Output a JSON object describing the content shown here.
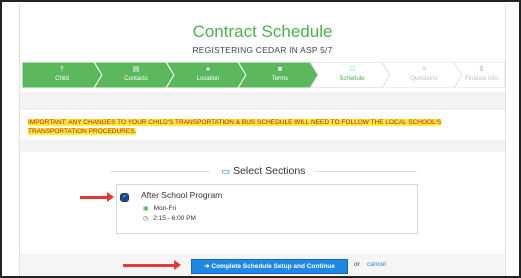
{
  "header": {
    "title": "Contract Schedule",
    "subtitle": "REGISTERING CEDAR IN ASP 5/7"
  },
  "steps": [
    {
      "label": "Child",
      "icon": "person-icon",
      "glyph": "†",
      "status": "done"
    },
    {
      "label": "Contacts",
      "icon": "contacts-icon",
      "glyph": "▤",
      "status": "done"
    },
    {
      "label": "Location",
      "icon": "location-pin-icon",
      "glyph": "●",
      "status": "done"
    },
    {
      "label": "Terms",
      "icon": "document-icon",
      "glyph": "■",
      "status": "done"
    },
    {
      "label": "Schedule",
      "icon": "calendar-icon",
      "glyph": "□",
      "status": "current"
    },
    {
      "label": "Questions",
      "icon": "list-icon",
      "glyph": "≡",
      "status": "todo"
    },
    {
      "label": "Finance Info",
      "icon": "dollar-icon",
      "glyph": "$",
      "status": "todo"
    }
  ],
  "notice": "IMPORTANT: ANY CHANGES TO YOUR CHILD'S TRANSPORTATION & BUS SCHEDULE WILL NEED TO FOLLOW THE LOCAL SCHOOL'S TRANSPORTATION PROCEDURES.",
  "sections": {
    "heading": "Select Sections",
    "items": [
      {
        "name": "After School Program",
        "days": "Mon-Fri",
        "time": "2:15 - 6:00 PM",
        "checked": true
      }
    ]
  },
  "actions": {
    "complete_label": "Complete Schedule Setup and Continue",
    "or_text": "or",
    "cancel_label": "cancel"
  },
  "colors": {
    "step_done": "#5cb85c",
    "step_current": "#ffffff",
    "step_todo": "#ffffff",
    "title": "#4caf50",
    "primary_button": "#1e88e5",
    "notice_highlight": "#ffeb3b",
    "notice_text": "#b71c1c",
    "annotation_arrow": "#e53935"
  }
}
